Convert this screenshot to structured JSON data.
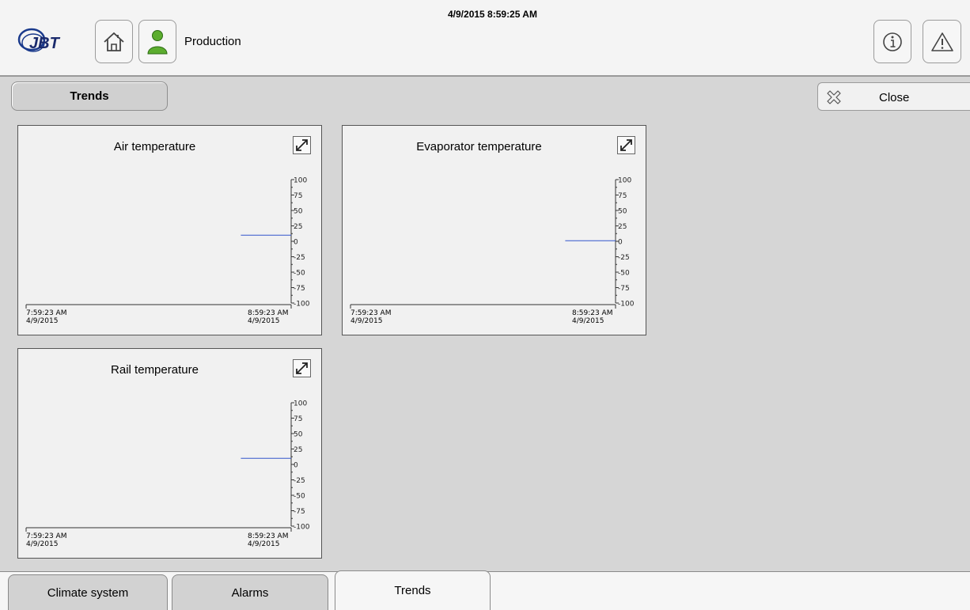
{
  "header": {
    "timestamp": "4/9/2015 8:59:25 AM",
    "user_label": "Production",
    "logo": "JBT"
  },
  "toolbar": {
    "section_label": "Trends",
    "close_label": "Close"
  },
  "trend_panels": [
    {
      "title": "Air temperature"
    },
    {
      "title": "Evaporator temperature"
    },
    {
      "title": "Rail temperature"
    }
  ],
  "chart_data": [
    {
      "type": "line",
      "title": "Air temperature",
      "x_start": {
        "time": "7:59:23 AM",
        "date": "4/9/2015"
      },
      "x_end": {
        "time": "8:59:23 AM",
        "date": "4/9/2015"
      },
      "ylim": [
        -100,
        100
      ],
      "y_ticks": [
        "100",
        "75",
        "50",
        "25",
        "0",
        "-25",
        "-50",
        "-75",
        "-100"
      ],
      "series": [
        {
          "points": [
            {
              "x": "8:48:00 AM",
              "y": 10
            },
            {
              "x": "8:59:23 AM",
              "y": 10
            }
          ],
          "color": "#3355cc"
        }
      ]
    },
    {
      "type": "line",
      "title": "Evaporator temperature",
      "x_start": {
        "time": "7:59:23 AM",
        "date": "4/9/2015"
      },
      "x_end": {
        "time": "8:59:23 AM",
        "date": "4/9/2015"
      },
      "ylim": [
        -100,
        100
      ],
      "y_ticks": [
        "100",
        "75",
        "50",
        "25",
        "0",
        "-25",
        "-50",
        "-75",
        "-100"
      ],
      "series": [
        {
          "points": [
            {
              "x": "8:48:00 AM",
              "y": 1
            },
            {
              "x": "8:59:23 AM",
              "y": 1
            }
          ],
          "color": "#3355cc"
        }
      ]
    },
    {
      "type": "line",
      "title": "Rail temperature",
      "x_start": {
        "time": "7:59:23 AM",
        "date": "4/9/2015"
      },
      "x_end": {
        "time": "8:59:23 AM",
        "date": "4/9/2015"
      },
      "ylim": [
        -100,
        100
      ],
      "y_ticks": [
        "100",
        "75",
        "50",
        "25",
        "0",
        "-25",
        "-50",
        "-75",
        "-100"
      ],
      "series": [
        {
          "points": [
            {
              "x": "8:48:00 AM",
              "y": 10
            },
            {
              "x": "8:59:23 AM",
              "y": 10
            }
          ],
          "color": "#3355cc"
        }
      ]
    }
  ],
  "tabs": [
    {
      "label": "Climate system",
      "active": false
    },
    {
      "label": "Alarms",
      "active": false
    },
    {
      "label": "Trends",
      "active": true
    }
  ],
  "icons": {
    "logo": "jbt-logo",
    "home": "home-icon",
    "user": "user-icon",
    "info": "info-icon",
    "alarm": "warning-icon",
    "close": "close-icon",
    "expand": "expand-icon"
  },
  "colors": {
    "user_icon": "#5cad2f",
    "trend_line": "#3355cc"
  }
}
